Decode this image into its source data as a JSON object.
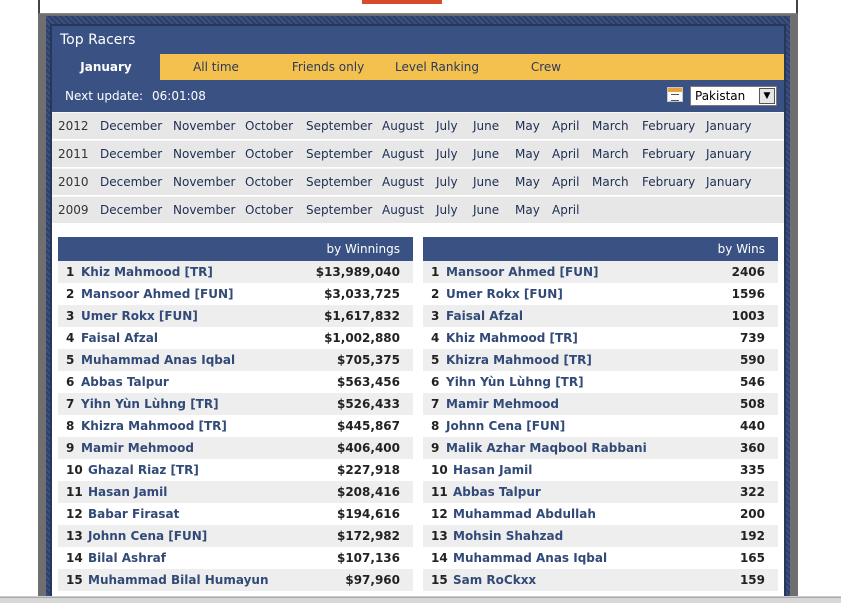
{
  "header": {
    "title": "Top Racers"
  },
  "tabs": [
    {
      "label": "January"
    },
    {
      "label": "All time"
    },
    {
      "label": "Friends only"
    },
    {
      "label": "Level Ranking"
    },
    {
      "label": "Crew"
    }
  ],
  "update": {
    "label": "Next update:",
    "time": "06:01:08",
    "country": "Pakistan"
  },
  "years": [
    {
      "year": "2012",
      "months": [
        "December",
        "November",
        "October",
        "September",
        "August",
        "July",
        "June",
        "May",
        "April",
        "March",
        "February",
        "January"
      ]
    },
    {
      "year": "2011",
      "months": [
        "December",
        "November",
        "October",
        "September",
        "August",
        "July",
        "June",
        "May",
        "April",
        "March",
        "February",
        "January"
      ]
    },
    {
      "year": "2010",
      "months": [
        "December",
        "November",
        "October",
        "September",
        "August",
        "July",
        "June",
        "May",
        "April",
        "March",
        "February",
        "January"
      ]
    },
    {
      "year": "2009",
      "months": [
        "December",
        "November",
        "October",
        "September",
        "August",
        "July",
        "June",
        "May",
        "April"
      ]
    }
  ],
  "winnings": {
    "header": "by Winnings",
    "rows": [
      {
        "rank": "1",
        "name": "Khiz Mahmood [TR]",
        "value": "$13,989,040"
      },
      {
        "rank": "2",
        "name": "Mansoor Ahmed [FUN]",
        "value": "$3,033,725"
      },
      {
        "rank": "3",
        "name": "Umer Rokx [FUN]",
        "value": "$1,617,832"
      },
      {
        "rank": "4",
        "name": "Faisal Afzal",
        "value": "$1,002,880"
      },
      {
        "rank": "5",
        "name": "Muhammad Anas Iqbal",
        "value": "$705,375"
      },
      {
        "rank": "6",
        "name": "Abbas Talpur",
        "value": "$563,456"
      },
      {
        "rank": "7",
        "name": "Yihn Yùn Lùhng [TR]",
        "value": "$526,433"
      },
      {
        "rank": "8",
        "name": "Khizra Mahmood [TR]",
        "value": "$445,867"
      },
      {
        "rank": "9",
        "name": "Mamir Mehmood",
        "value": "$406,400"
      },
      {
        "rank": "10",
        "name": "Ghazal Riaz [TR]",
        "value": "$227,918"
      },
      {
        "rank": "11",
        "name": "Hasan Jamil",
        "value": "$208,416"
      },
      {
        "rank": "12",
        "name": "Babar Firasat",
        "value": "$194,616"
      },
      {
        "rank": "13",
        "name": "Johnn Cena [FUN]",
        "value": "$172,982"
      },
      {
        "rank": "14",
        "name": "Bilal Ashraf",
        "value": "$107,136"
      },
      {
        "rank": "15",
        "name": "Muhammad Bilal Humayun",
        "value": "$97,960"
      }
    ]
  },
  "wins": {
    "header": "by Wins",
    "rows": [
      {
        "rank": "1",
        "name": "Mansoor Ahmed [FUN]",
        "value": "2406"
      },
      {
        "rank": "2",
        "name": "Umer Rokx [FUN]",
        "value": "1596"
      },
      {
        "rank": "3",
        "name": "Faisal Afzal",
        "value": "1003"
      },
      {
        "rank": "4",
        "name": "Khiz Mahmood [TR]",
        "value": "739"
      },
      {
        "rank": "5",
        "name": "Khizra Mahmood [TR]",
        "value": "590"
      },
      {
        "rank": "6",
        "name": "Yihn Yùn Lùhng [TR]",
        "value": "546"
      },
      {
        "rank": "7",
        "name": "Mamir Mehmood",
        "value": "508"
      },
      {
        "rank": "8",
        "name": "Johnn Cena [FUN]",
        "value": "440"
      },
      {
        "rank": "9",
        "name": "Malik Azhar Maqbool Rabbani",
        "value": "360"
      },
      {
        "rank": "10",
        "name": "Hasan Jamil",
        "value": "335"
      },
      {
        "rank": "11",
        "name": "Abbas Talpur",
        "value": "322"
      },
      {
        "rank": "12",
        "name": "Muhammad Abdullah",
        "value": "200"
      },
      {
        "rank": "13",
        "name": "Mohsin Shahzad",
        "value": "192"
      },
      {
        "rank": "14",
        "name": "Muhammad Anas Iqbal",
        "value": "165"
      },
      {
        "rank": "15",
        "name": "Sam RoCkxx",
        "value": "159"
      }
    ]
  }
}
